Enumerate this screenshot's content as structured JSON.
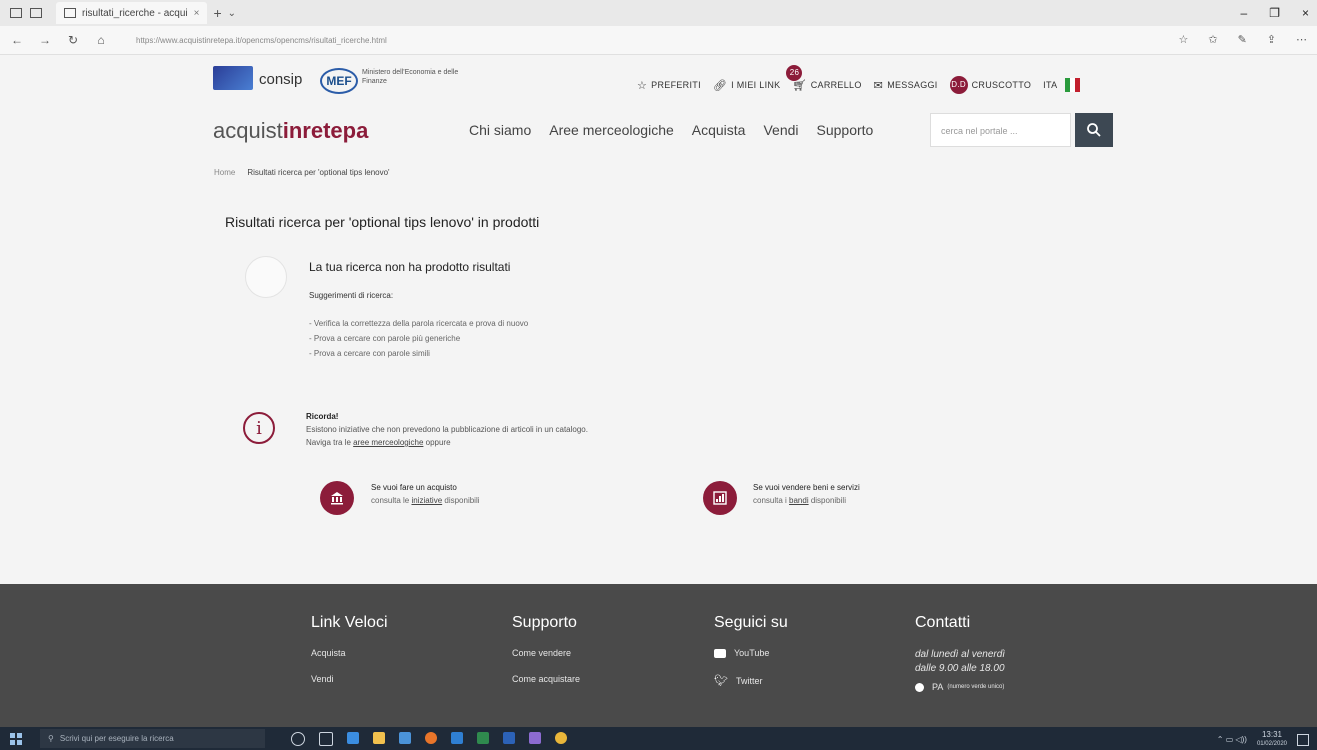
{
  "browser": {
    "tab_title": "risultati_ricerche - acqui",
    "tab_close": "×",
    "new_tab": "+",
    "tab_menu": "⌄",
    "url": "https://www.acquistinretepa.it/opencms/opencms/risultati_ricerche.html",
    "window_controls": [
      "–",
      "❐",
      "×"
    ],
    "toolbar_icons": [
      "☆",
      "✩",
      "✎",
      "⇪",
      "⋯"
    ]
  },
  "header": {
    "consip": "consip",
    "mef": "MEF",
    "mef_text": "Ministero dell'Economia e delle Finanze",
    "links": {
      "preferiti": "PREFERITI",
      "link": "I MIEI LINK",
      "cart_count": "26",
      "carrello": "CARRELLO",
      "messaggi": "MESSAGGI",
      "avatar": "D.D",
      "cruscotto": "CRUSCOTTO",
      "lang": "ITA"
    },
    "brand_prefix": "acquist",
    "brand_bold": "inrete",
    "brand_suffix": "pa",
    "nav": [
      "Chi siamo",
      "Aree merceologiche",
      "Acquista",
      "Vendi",
      "Supporto"
    ],
    "search_placeholder": "cerca nel portale ..."
  },
  "breadcrumb": {
    "home": "Home",
    "current": "Risultati ricerca per 'optional tips lenovo'"
  },
  "results": {
    "title": "Risultati ricerca per 'optional tips lenovo' in prodotti",
    "noresult": "La tua ricerca non ha prodotto risultati",
    "suggest_title": "Suggerimenti di ricerca:",
    "suggestions": [
      "- Verifica la correttezza della parola ricercata e prova di nuovo",
      "- Prova a cercare con parole più generiche",
      "- Prova a cercare con parole simili"
    ]
  },
  "remember": {
    "title": "Ricorda!",
    "line1": "Esistono iniziative che non prevedono la pubblicazione di articoli in un catalogo.",
    "line2_prefix": "Naviga tra le ",
    "line2_link": "aree merceologiche",
    "line2_suffix": " oppure"
  },
  "cta": {
    "buy_title": "Se vuoi fare un acquisto",
    "buy_prefix": "consulta le ",
    "buy_link": "iniziative",
    "buy_suffix": " disponibili",
    "sell_title": "Se vuoi vendere beni e servizi",
    "sell_prefix": "consulta i ",
    "sell_link": "bandi",
    "sell_suffix": " disponibili"
  },
  "footer": {
    "link_title": "Link Veloci",
    "link_items": [
      "Acquista",
      "Vendi"
    ],
    "support_title": "Supporto",
    "support_items": [
      "Come vendere",
      "Come acquistare"
    ],
    "follow_title": "Seguici su",
    "follow_items": [
      "YouTube",
      "Twitter"
    ],
    "contact_title": "Contatti",
    "contact_line1": "dal lunedì al venerdì",
    "contact_line2": "dalle 9.00 alle 18.00",
    "contact_pa": "PA",
    "contact_pa_note": "(numero verde unico)"
  },
  "taskbar": {
    "search": "Scrivi qui per eseguire la ricerca",
    "time": "13:31",
    "date": "01/02/2020"
  },
  "colors": {
    "accent": "#8c1c3a",
    "footer": "#4a4a4a",
    "search_button": "#3d4853"
  }
}
